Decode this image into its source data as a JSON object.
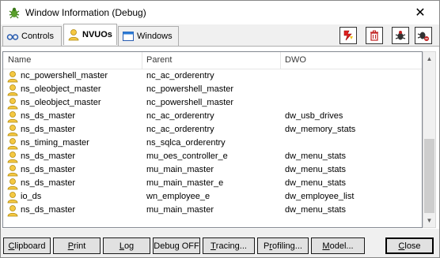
{
  "window": {
    "title": "Window Information (Debug)",
    "close_glyph": "✕"
  },
  "tabs": [
    {
      "label": "Controls",
      "icon": "glasses-icon",
      "active": false
    },
    {
      "label": "NVUOs",
      "icon": "user-icon",
      "active": true
    },
    {
      "label": "Windows",
      "icon": "window-icon",
      "active": false
    }
  ],
  "toolbar": {
    "buttons": [
      {
        "name": "debug-flash-button",
        "icon": "flash-icon"
      },
      {
        "name": "delete-button",
        "icon": "trash-icon"
      },
      {
        "name": "bug-button",
        "icon": "bug-icon"
      },
      {
        "name": "bug-stop-button",
        "icon": "bug-stop-icon"
      }
    ]
  },
  "list": {
    "columns": [
      "Name",
      "Parent",
      "DWO"
    ],
    "rows": [
      {
        "name": "nc_powershell_master",
        "parent": "nc_ac_orderentry",
        "dwo": ""
      },
      {
        "name": "ns_oleobject_master",
        "parent": "nc_powershell_master",
        "dwo": ""
      },
      {
        "name": "ns_oleobject_master",
        "parent": "nc_powershell_master",
        "dwo": ""
      },
      {
        "name": "ns_ds_master",
        "parent": "nc_ac_orderentry",
        "dwo": "dw_usb_drives"
      },
      {
        "name": "ns_ds_master",
        "parent": "nc_ac_orderentry",
        "dwo": "dw_memory_stats"
      },
      {
        "name": "ns_timing_master",
        "parent": "ns_sqlca_orderentry",
        "dwo": ""
      },
      {
        "name": "ns_ds_master",
        "parent": "mu_oes_controller_e",
        "dwo": "dw_menu_stats"
      },
      {
        "name": "ns_ds_master",
        "parent": "mu_main_master",
        "dwo": "dw_menu_stats"
      },
      {
        "name": "ns_ds_master",
        "parent": "mu_main_master_e",
        "dwo": "dw_menu_stats"
      },
      {
        "name": "io_ds",
        "parent": "wn_employee_e",
        "dwo": "dw_employee_list"
      },
      {
        "name": "ns_ds_master",
        "parent": "mu_main_master",
        "dwo": "dw_menu_stats"
      }
    ]
  },
  "buttons": {
    "clipboard": {
      "u": "C",
      "rest": "lipboard"
    },
    "print": {
      "u": "P",
      "rest": "rint"
    },
    "log": {
      "pre": "",
      "u": "L",
      "rest": "og"
    },
    "debug": "Debug OFF",
    "tracing": {
      "u": "T",
      "rest": "racing..."
    },
    "profiling": {
      "pre": "P",
      "u": "r",
      "rest": "ofiling..."
    },
    "model": {
      "u": "M",
      "rest": "odel..."
    },
    "close": {
      "u": "C",
      "rest": "lose"
    }
  }
}
